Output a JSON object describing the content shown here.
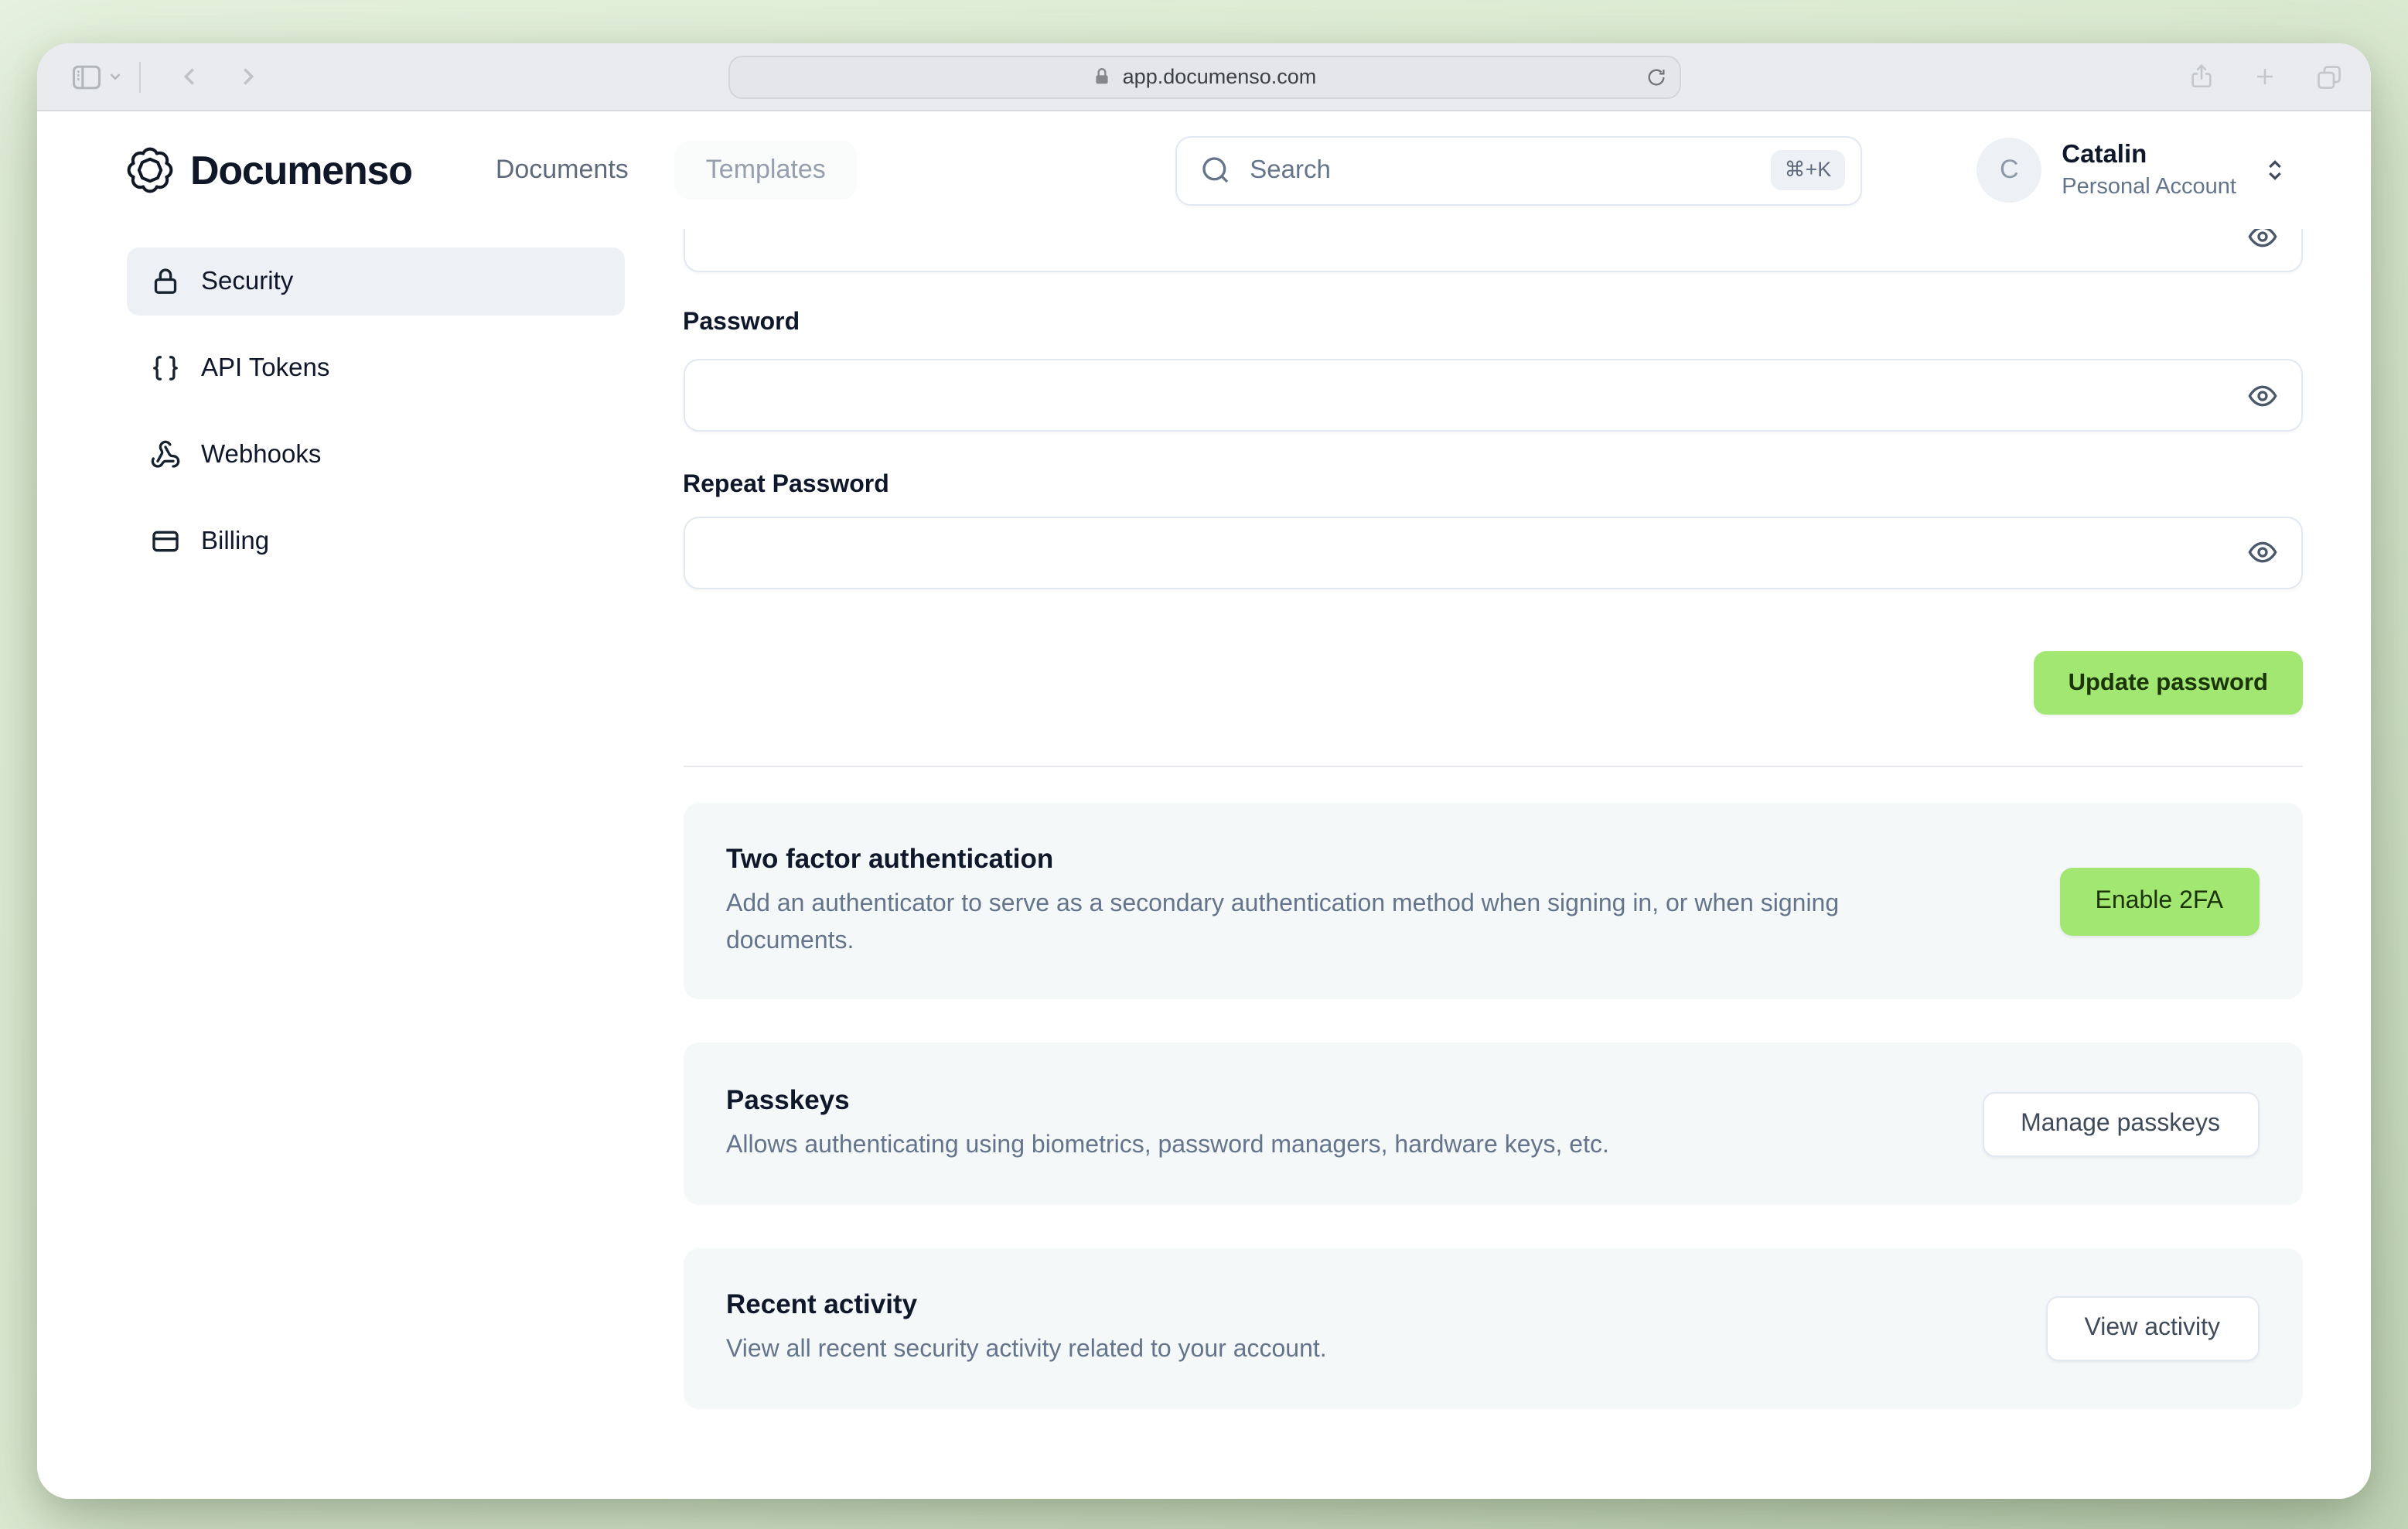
{
  "browser": {
    "url": "app.documenso.com",
    "toolbar_icons": [
      "sidebar-toggle-icon",
      "chevron-down-icon",
      "back-icon",
      "forward-icon",
      "lock-icon",
      "reload-icon",
      "share-icon",
      "new-tab-icon",
      "tabs-icon"
    ]
  },
  "header": {
    "brand": "Documenso",
    "nav": [
      {
        "label": "Documents"
      },
      {
        "label": "Templates"
      }
    ],
    "search": {
      "placeholder": "Search",
      "shortcut": "⌘+K"
    },
    "account": {
      "initial": "C",
      "name": "Catalin",
      "type": "Personal Account"
    }
  },
  "sidebar": {
    "items": [
      {
        "label": "Security",
        "icon": "lock-icon",
        "active": true
      },
      {
        "label": "API Tokens",
        "icon": "braces-icon",
        "active": false
      },
      {
        "label": "Webhooks",
        "icon": "webhook-icon",
        "active": false
      },
      {
        "label": "Billing",
        "icon": "credit-card-icon",
        "active": false
      }
    ]
  },
  "main": {
    "form": {
      "password_label": "Password",
      "repeat_password_label": "Repeat Password",
      "submit_label": "Update password"
    },
    "sections": [
      {
        "title": "Two factor authentication",
        "description": "Add an authenticator to serve as a secondary authentication method when signing in, or when signing documents.",
        "button": "Enable 2FA",
        "button_style": "primary"
      },
      {
        "title": "Passkeys",
        "description": "Allows authenticating using biometrics, password managers, hardware keys, etc.",
        "button": "Manage passkeys",
        "button_style": "outline"
      },
      {
        "title": "Recent activity",
        "description": "View all recent security activity related to your account.",
        "button": "View activity",
        "button_style": "outline"
      }
    ]
  },
  "colors": {
    "accent_green": "#a2e771",
    "desktop_background": "#dfeed7",
    "sidebar_active_bg": "#edf1f6",
    "card_bg": "#f4f8f9",
    "text_dark": "#0f172a",
    "text_muted": "#64748b"
  }
}
